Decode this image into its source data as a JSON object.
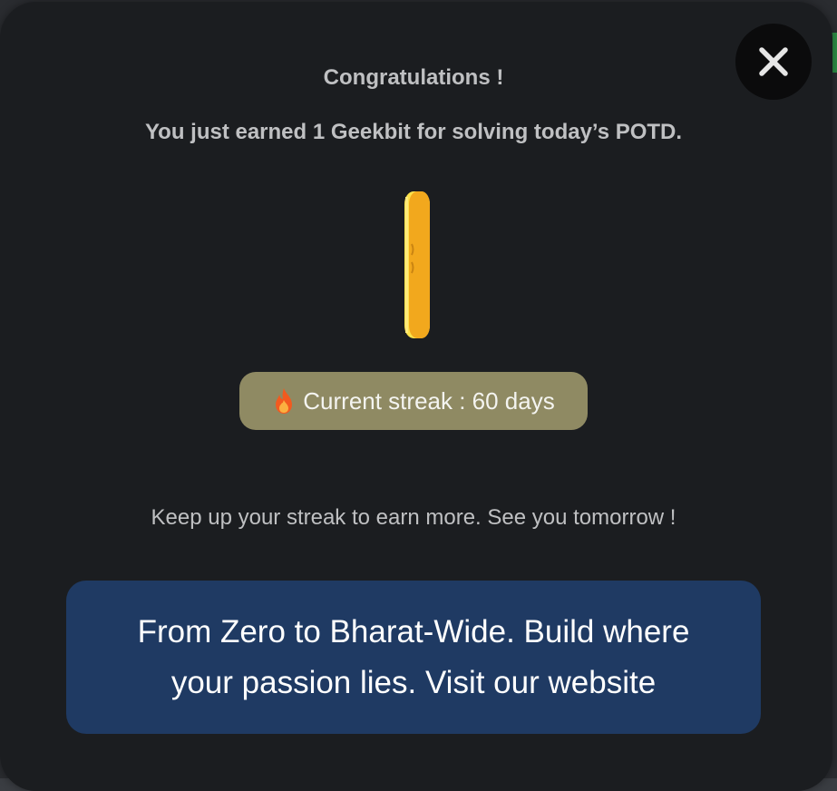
{
  "popup": {
    "title": "Congratulations !",
    "message": "You just earned 1 Geekbit for solving today’s POTD.",
    "streak_label": "Current streak : 60 days",
    "footer_message": "Keep up your streak to earn more. See you tomorrow !",
    "promo_text": "From Zero to Bharat-Wide. Build where your passion lies. Visit our website"
  },
  "icons": {
    "close": "close-icon",
    "coin": "coin-icon",
    "streak": "flame-icon"
  },
  "colors": {
    "modal_bg": "#1b1d20",
    "text_muted": "#bfc0c2",
    "streak_pill": "#8f8a63",
    "promo_bg": "#1f3a63",
    "coin": "#f2a81d",
    "accent_green": "#2f8d46"
  }
}
